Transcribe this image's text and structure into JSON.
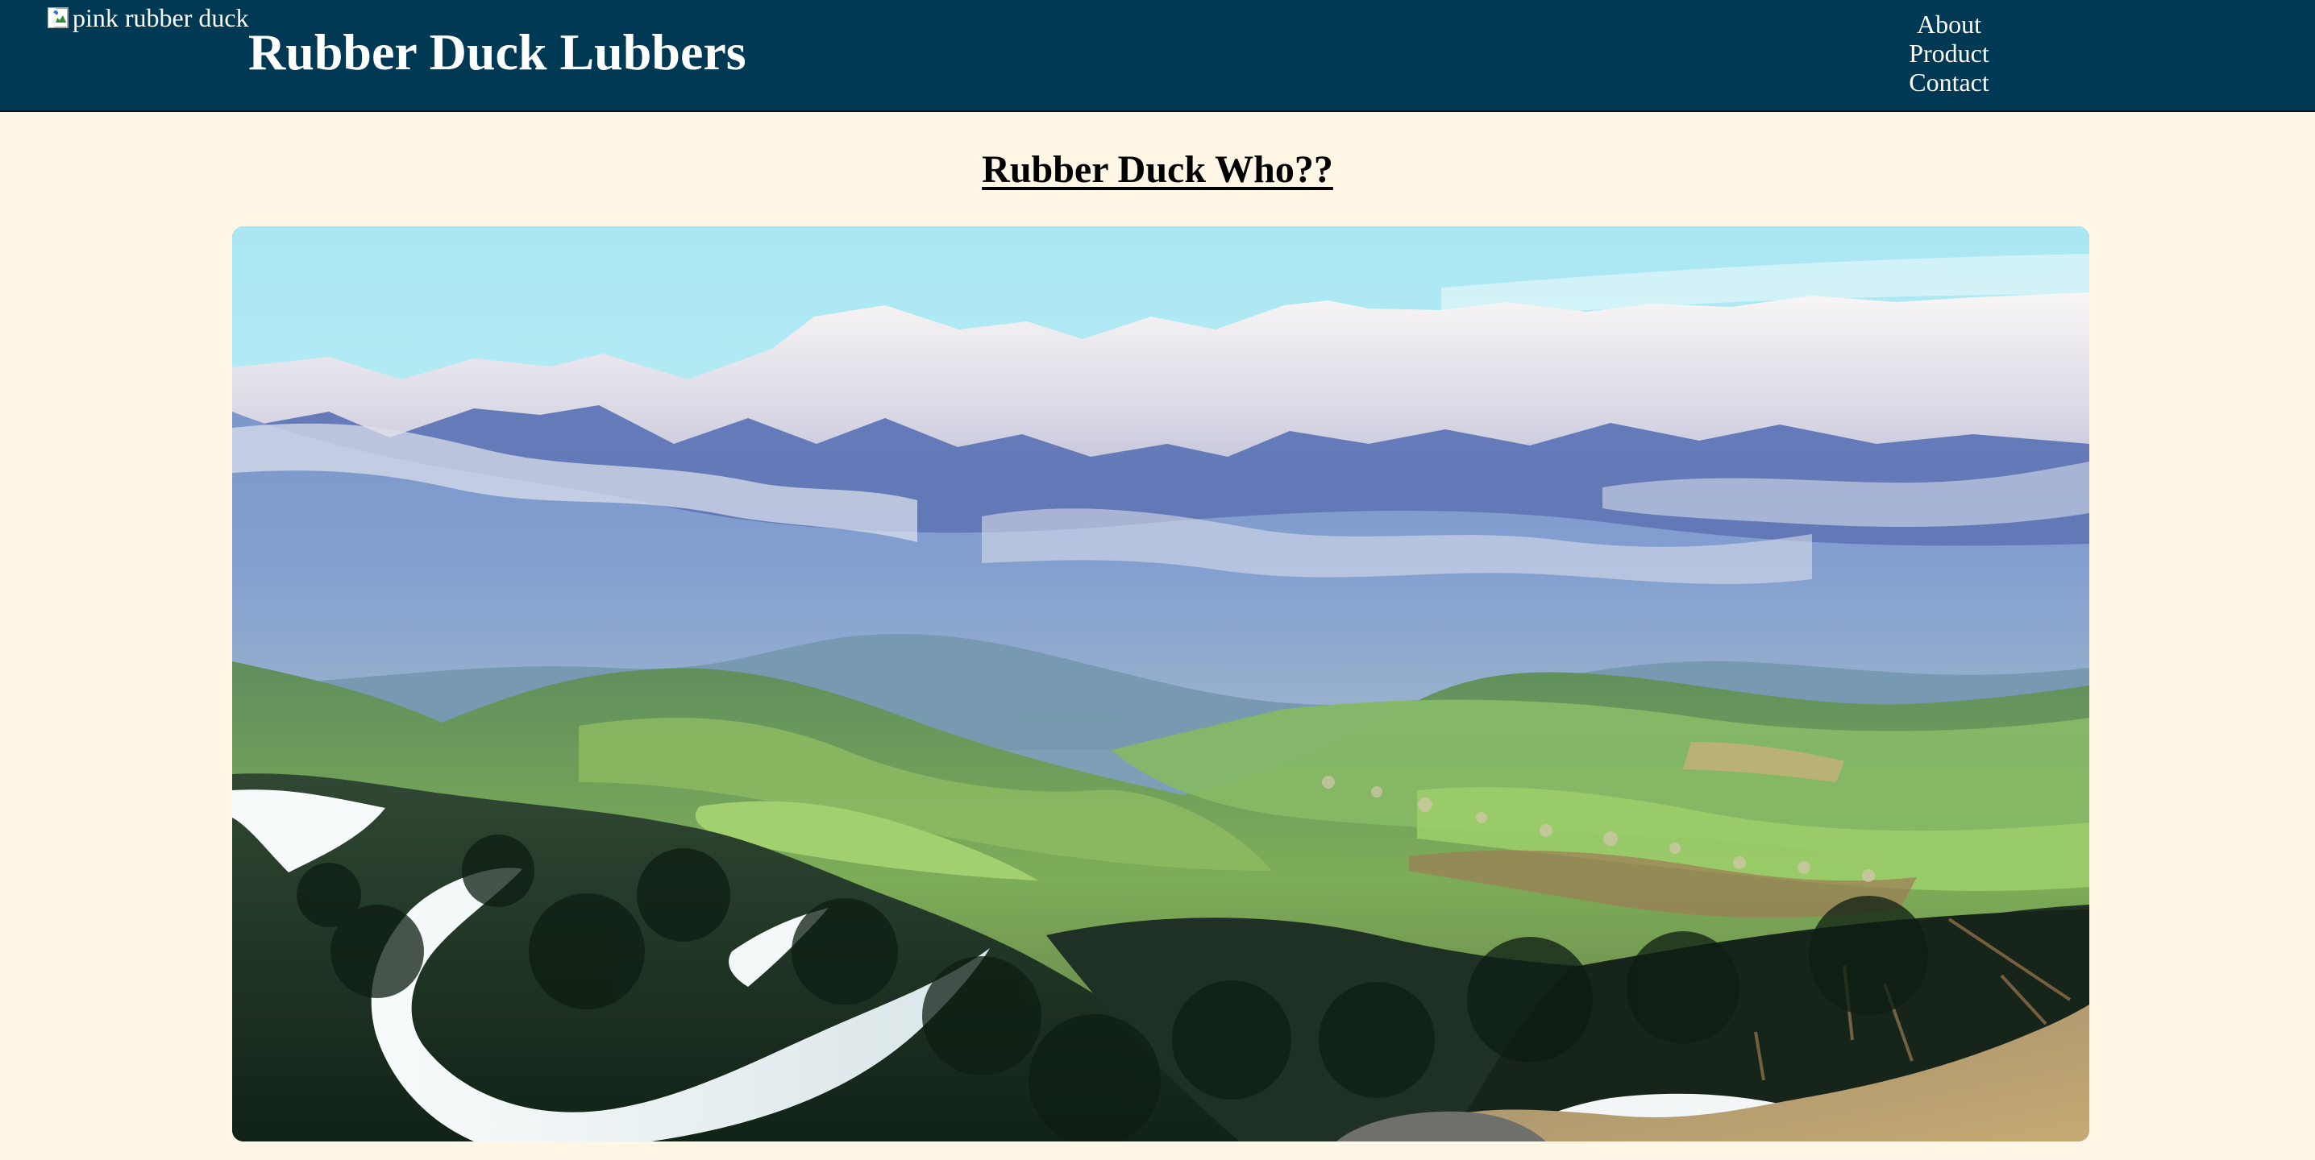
{
  "header": {
    "logo_alt": "pink rubber duck",
    "site_title": "Rubber Duck Lubbers",
    "nav": [
      "About",
      "Product",
      "Contact"
    ]
  },
  "main": {
    "section_title": "Rubber Duck Who??",
    "hero_image_alt": "mountain valley landscape with snowy peaks and ski slopes"
  },
  "colors": {
    "header_background": "#003954",
    "page_background": "#fff6e6",
    "header_text": "#ffffff"
  }
}
